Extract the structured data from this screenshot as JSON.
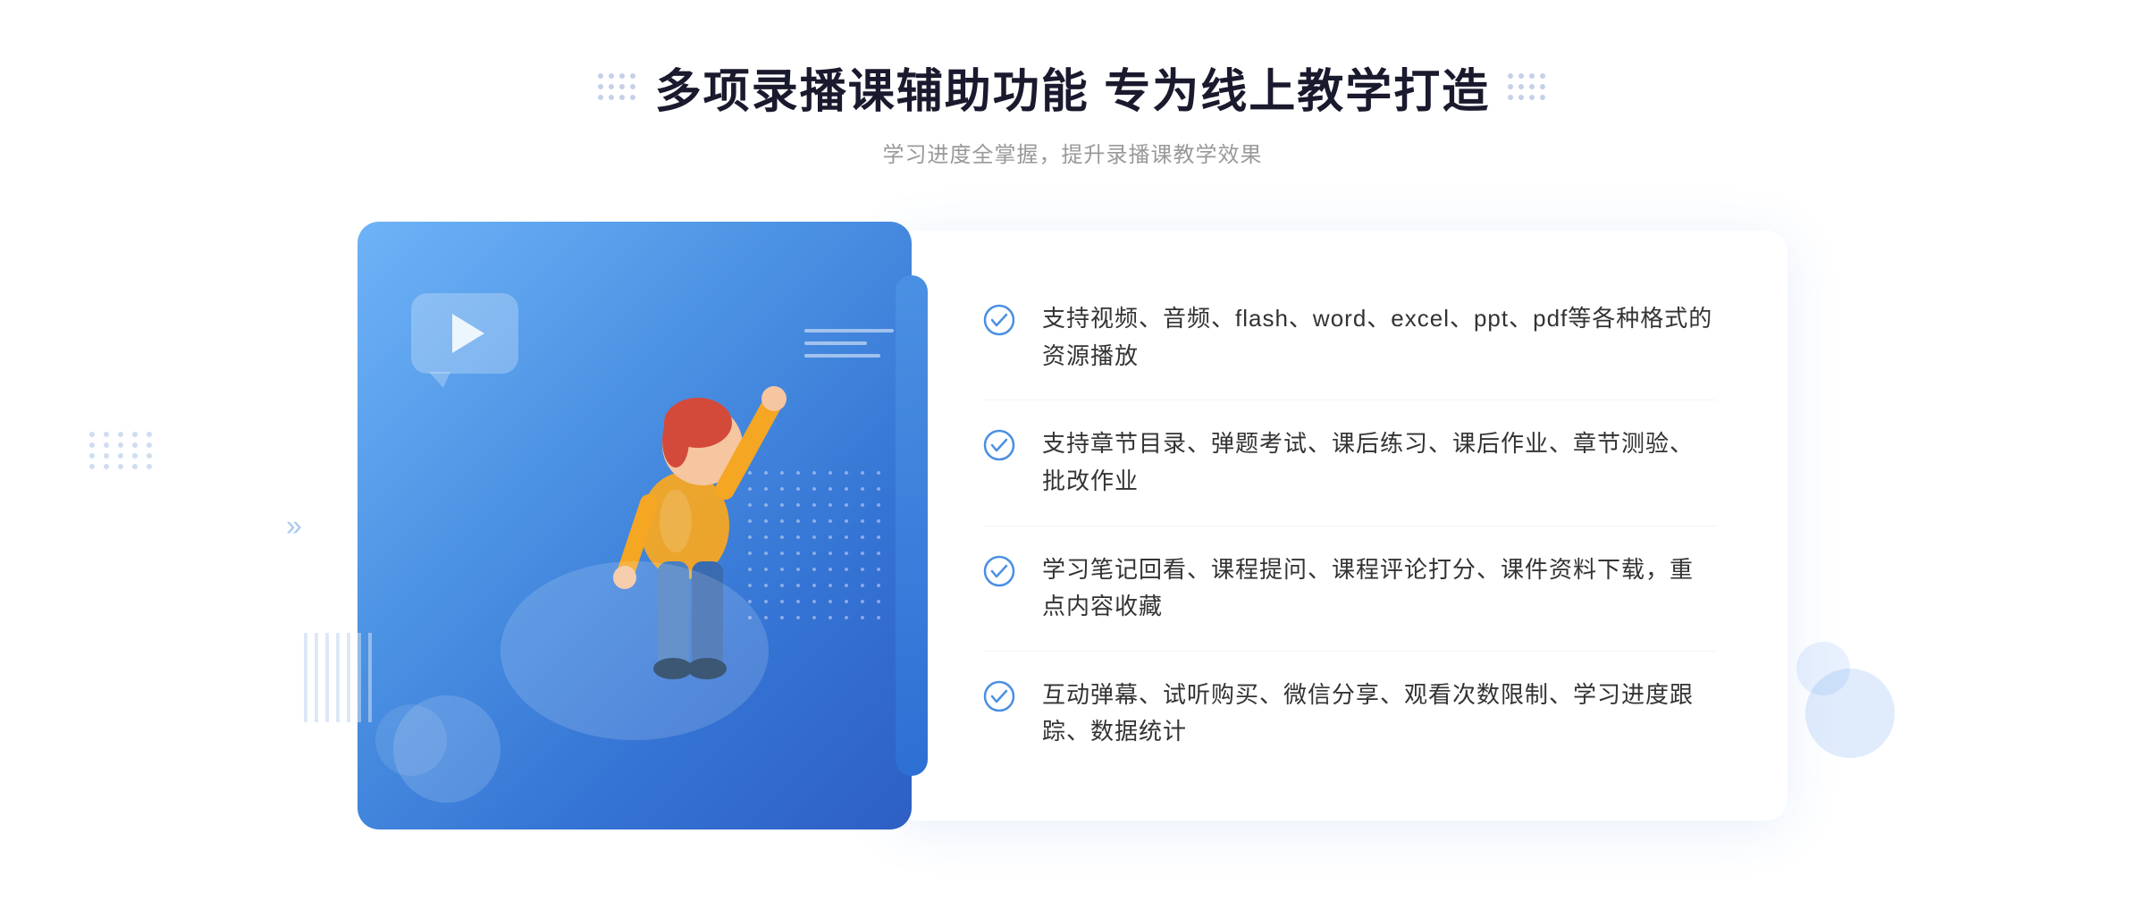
{
  "page": {
    "title": "多项录播课辅助功能 专为线上教学打造",
    "subtitle": "学习进度全掌握，提升录播课教学效果"
  },
  "features": [
    {
      "id": "feature-1",
      "text": "支持视频、音频、flash、word、excel、ppt、pdf等各种格式的资源播放"
    },
    {
      "id": "feature-2",
      "text": "支持章节目录、弹题考试、课后练习、课后作业、章节测验、批改作业"
    },
    {
      "id": "feature-3",
      "text": "学习笔记回看、课程提问、课程评论打分、课件资料下载，重点内容收藏"
    },
    {
      "id": "feature-4",
      "text": "互动弹幕、试听购买、微信分享、观看次数限制、学习进度跟踪、数据统计"
    }
  ],
  "icons": {
    "check_color": "#4a90e2",
    "title_dot_color": "#c5d0e8"
  }
}
